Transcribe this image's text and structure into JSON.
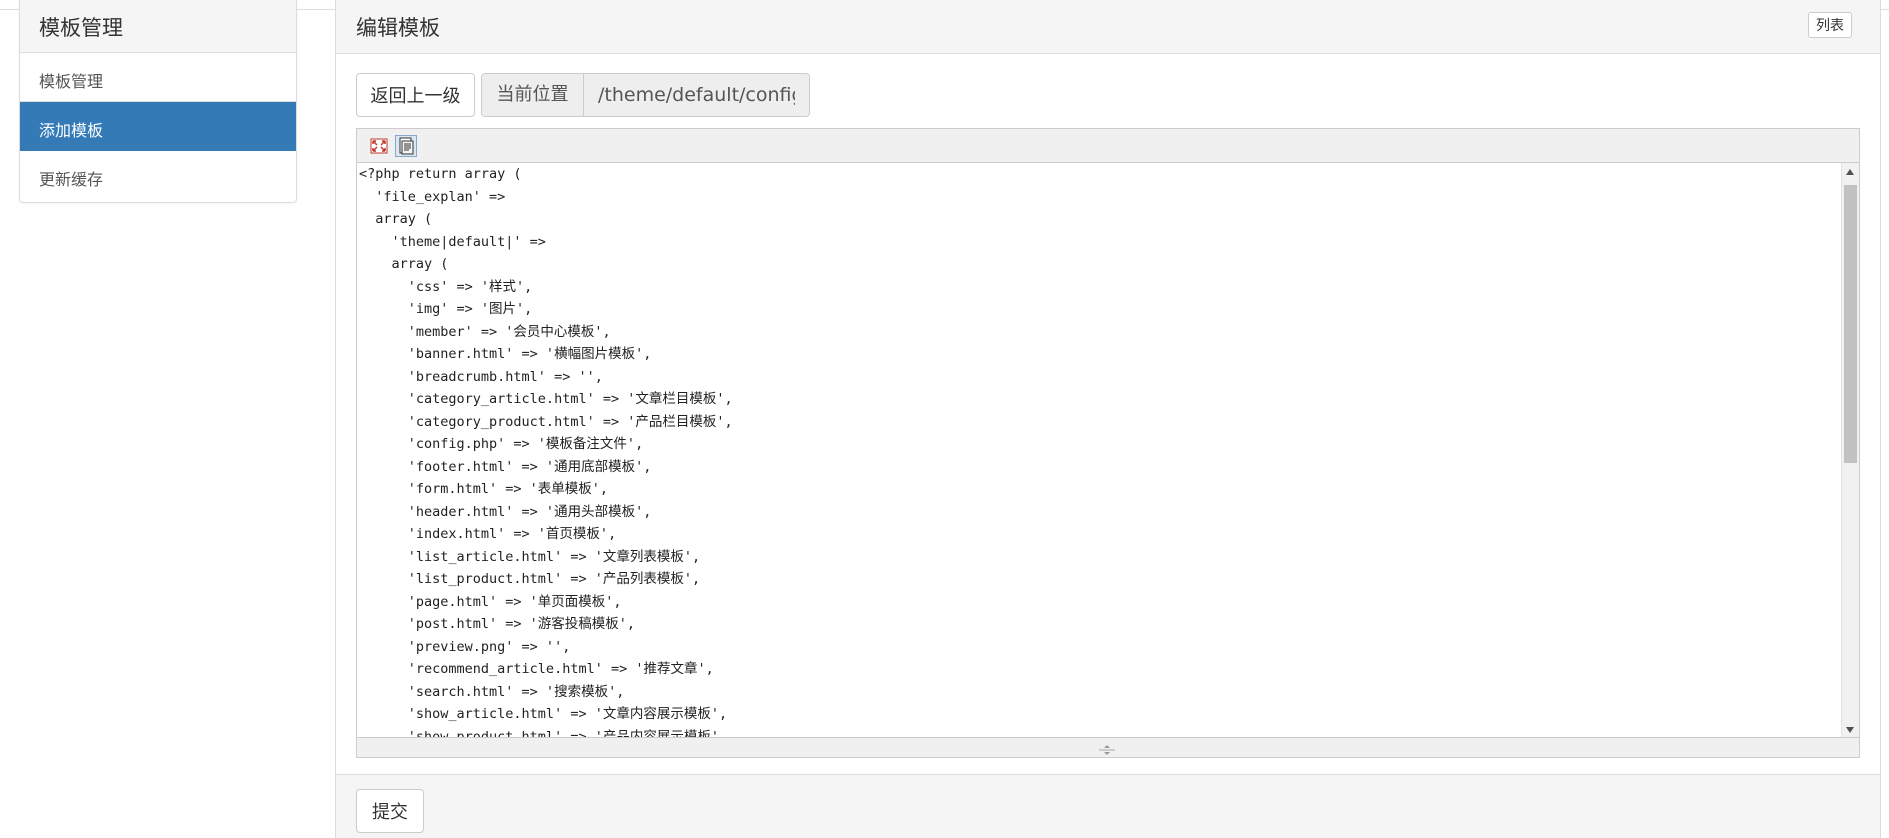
{
  "sidebar": {
    "title": "模板管理",
    "items": [
      {
        "label": "模板管理",
        "active": false
      },
      {
        "label": "添加模板",
        "active": true
      },
      {
        "label": "更新缓存",
        "active": false
      }
    ]
  },
  "panel": {
    "title": "编辑模板",
    "list_button": "列表",
    "back_button": "返回上一级",
    "location_label": "当前位置",
    "location_value": "/theme/default/config.php",
    "submit_button": "提交"
  },
  "editor": {
    "lines": [
      "<?php return array (",
      "  'file_explan' =>",
      "  array (",
      "    'theme|default|' =>",
      "    array (",
      "      'css' => '样式',",
      "      'img' => '图片',",
      "      'member' => '会员中心模板',",
      "      'banner.html' => '横幅图片模板',",
      "      'breadcrumb.html' => '',",
      "      'category_article.html' => '文章栏目模板',",
      "      'category_product.html' => '产品栏目模板',",
      "      'config.php' => '模板备注文件',",
      "      'footer.html' => '通用底部模板',",
      "      'form.html' => '表单模板',",
      "      'header.html' => '通用头部模板',",
      "      'index.html' => '首页模板',",
      "      'list_article.html' => '文章列表模板',",
      "      'list_product.html' => '产品列表模板',",
      "      'page.html' => '单页面模板',",
      "      'post.html' => '游客投稿模板',",
      "      'preview.png' => '',",
      "      'recommend_article.html' => '推荐文章',",
      "      'search.html' => '搜索模板',",
      "      'show_article.html' => '文章内容展示模板',",
      "      'show_product.html' => '产品内容展示模板',"
    ]
  },
  "icons": {
    "fullscreen": "fullscreen-icon",
    "source": "source-icon",
    "resize": "resize-handle-icon"
  },
  "colors": {
    "accent": "#337ab7",
    "panel_bg": "#f5f5f5",
    "border": "#dddddd"
  }
}
